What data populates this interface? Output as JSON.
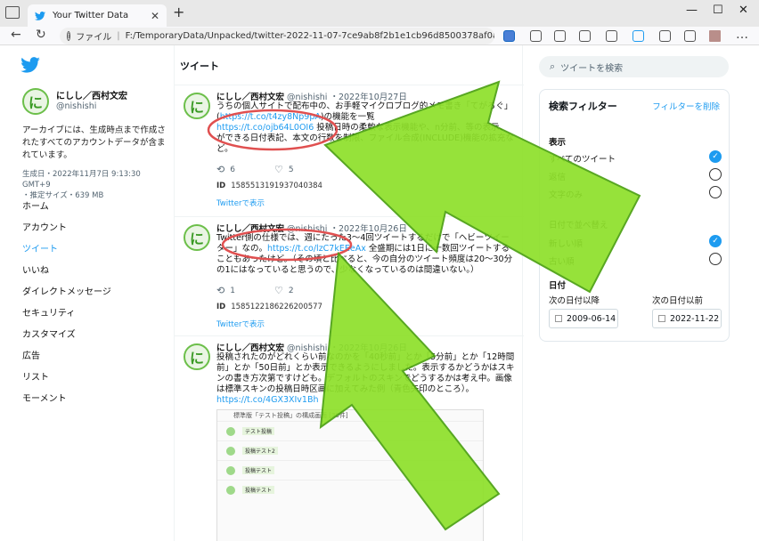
{
  "browser": {
    "tab_title": "Your Twitter Data",
    "url_label": "ファイル",
    "url": "F:/TemporaryData/Unpacked/twitter-2022-11-07-7ce9ab8f2b1e1cb96d8500378af0a7629..."
  },
  "profile": {
    "name": "にしし／西村文宏",
    "handle": "@nishishi",
    "description": "アーカイブには、生成時点まで作成されたすべてのアカウントデータが含まれています。",
    "generated": "生成日・2022年11月7日 9:13:30 GMT+9",
    "size": "・推定サイズ・639 MB"
  },
  "nav": [
    "ホーム",
    "アカウント",
    "ツイート",
    "いいね",
    "ダイレクトメッセージ",
    "セキュリティ",
    "カスタマイズ",
    "広告",
    "リスト",
    "モーメント"
  ],
  "middle": {
    "heading": "ツイート",
    "tweets": [
      {
        "name": "にしし／西村文宏",
        "handle": "@nishishi",
        "date": "・2022年10月27日",
        "text_a": "うちの個人サイトで配布中の、お手軽マイクロブログ的メモ書き",
        "text_b": "「てがろぐ」(",
        "link1": "https://t.co/t4zy8Np9pA",
        "text_c": ")の",
        "text_d": "機能を一覧",
        "link2": "https://t.co/ojb64L0OI6",
        "text_e": " 投稿日時の柔軟な表示機能や、n分前、等の表示、ができる日付表記、本文の行数を制限、ファイル合成(INCLUDE)機能の拡充など。",
        "retweets": "6",
        "likes": "5",
        "id_label": "ID",
        "id": "1585513191937040384",
        "view": "Twitterで表示"
      },
      {
        "name": "にしし／西村文宏",
        "handle": "@nishishi",
        "date": "・2022年10月26日",
        "text_a": "Twitter側の仕様では、週にたった3～4回ツイートするだけで「ヘビーツイーター」なの。",
        "link1": "https://t.co/lzC7kEEeAx",
        "text_b": " 全盛期には1日に十数回ツイートすることもあったけど。（その頃と比べると、今の自分のツイート頻度は20～30分の1にはなっていると思うので、少なくなっているのは間違いない。）",
        "retweets": "1",
        "likes": "2",
        "id_label": "ID",
        "id": "1585122186226200577",
        "view": "Twitterで表示"
      },
      {
        "name": "にしし／西村文宏",
        "handle": "@nishishi",
        "date": "・2022年10月26日",
        "text_a": "投稿されたのがどれくらい前なのかを「40秒前」とか「5分前」とか「12時間前」とか「50日前」とか表示できるようにしました。表示するかどうかはスキンの書き方次第ですけども。デフォルトのスキンでどうするかは考え中。画像は標準スキンの投稿日時区画に加えてみた例（青色矢印のところ）。",
        "link1": "https://t.co/4GX3XIv1Bh",
        "embed_title": "標準版「テスト投稿」の構成画面 [30件]",
        "embed_items": [
          "テスト投稿",
          "投稿テスト2",
          "投稿テスト",
          "投稿テスト"
        ]
      }
    ]
  },
  "right": {
    "search_placeholder": "ツイートを検索",
    "filter_title": "検索フィルター",
    "filter_clear": "フィルターを削除",
    "show_label": "表示",
    "show_options": [
      "すべてのツイート",
      "返信",
      "文字のみ"
    ],
    "show_selected": 0,
    "sort_label": "日付で並べ替え",
    "sort_options": [
      "新しい順",
      "古い順"
    ],
    "sort_selected": 0,
    "date_label": "日付",
    "since_label": "次の日付以降",
    "until_label": "次の日付以前",
    "since_value": "2009-06-14",
    "until_value": "2022-11-22"
  },
  "colors": {
    "accent": "#1d9bf0",
    "arrow_green": "#8ee02a",
    "circle_red": "#e05050"
  }
}
